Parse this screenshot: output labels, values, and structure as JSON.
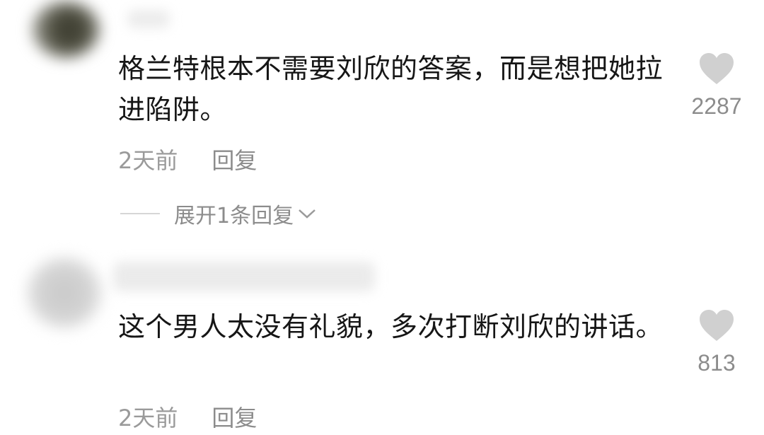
{
  "comments": [
    {
      "text": "格兰特根本不需要刘欣的答案，而是想把她拉进陷阱。",
      "time": "2天前",
      "reply_label": "回复",
      "likes": "2287",
      "expand_label": "展开1条回复"
    },
    {
      "text": "这个男人太没有礼貌，多次打断刘欣的讲话。",
      "time": "2天前",
      "reply_label": "回复",
      "likes": "813"
    }
  ],
  "icons": {
    "like": "heart-icon",
    "expand": "chevron-down-icon"
  },
  "colors": {
    "text": "#161616",
    "meta": "#9a9a9a",
    "heart": "#d0d0d0"
  }
}
